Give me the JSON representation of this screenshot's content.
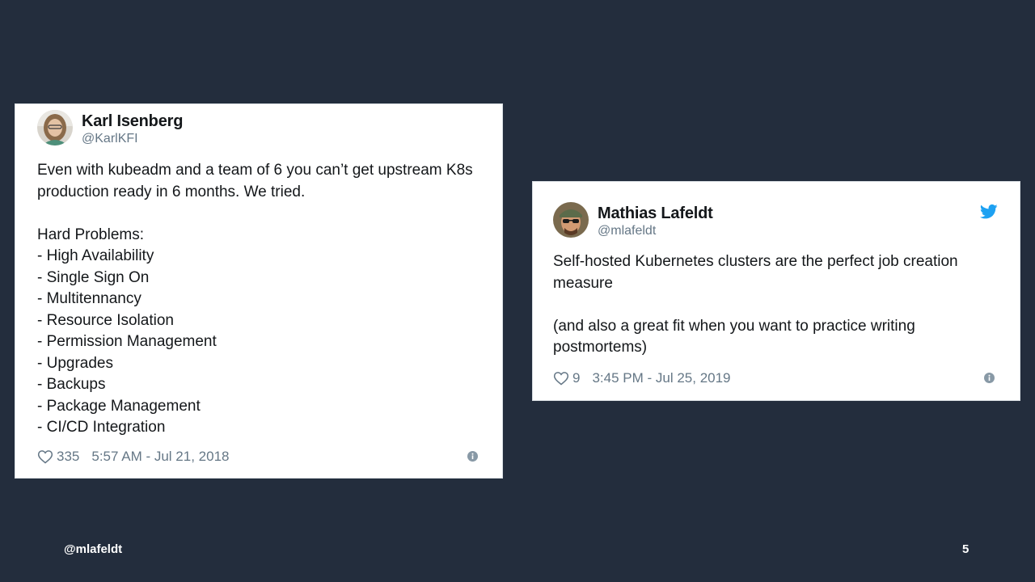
{
  "tweets": [
    {
      "display_name": "Karl Isenberg",
      "handle": "@KarlKFI",
      "text": "Even with kubeadm and a team of 6 you can’t get upstream K8s production ready in 6 months. We tried.\n\nHard Problems:\n- High Availability\n- Single Sign On\n- Multitennancy\n- Resource Isolation\n- Permission Management\n- Upgrades\n- Backups\n- Package Management\n- CI/CD Integration",
      "likes": "335",
      "timestamp": "5:57 AM - Jul 21, 2018",
      "icons": {
        "like": "heart-icon",
        "info": "info-icon"
      }
    },
    {
      "display_name": "Mathias Lafeldt",
      "handle": "@mlafeldt",
      "text": "Self-hosted Kubernetes clusters are the perfect job creation measure\n\n(and also a great fit when you want to practice writing postmortems)",
      "likes": "9",
      "timestamp": "3:45 PM - Jul 25, 2019",
      "icons": {
        "like": "heart-icon",
        "info": "info-icon",
        "brand": "twitter-bird-icon"
      }
    }
  ],
  "slide": {
    "footer_handle": "@mlafeldt",
    "page_number": "5"
  },
  "colors": {
    "background": "#232d3d",
    "card": "#ffffff",
    "text": "#14171a",
    "muted": "#657786",
    "twitter_blue": "#1da1f2"
  }
}
